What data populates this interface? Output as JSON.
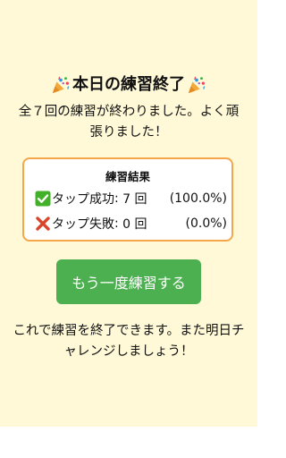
{
  "header": {
    "title": "本日の練習終了",
    "icon_left": "party-popper-icon",
    "icon_right": "party-popper-icon"
  },
  "message": "全７回の練習が終わりました。よく頑張りました！",
  "results": {
    "title": "練習結果",
    "rows": [
      {
        "icon": "check-mark-icon",
        "label": "タップ成功",
        "count": "7 回",
        "percent": "(100.0%)"
      },
      {
        "icon": "cross-mark-icon",
        "label": "タップ失敗",
        "count": "0 回",
        "percent": "(0.0%)"
      }
    ]
  },
  "retry_button": {
    "label": "もう一度練習する"
  },
  "footer_message": "これで練習を終了できます。また明日チャレンジしましょう！",
  "colors": {
    "background": "#fff9d8",
    "box_border": "#f3a74a",
    "button": "#4caf50",
    "check": "#43b02a",
    "cross": "#d9452b"
  }
}
